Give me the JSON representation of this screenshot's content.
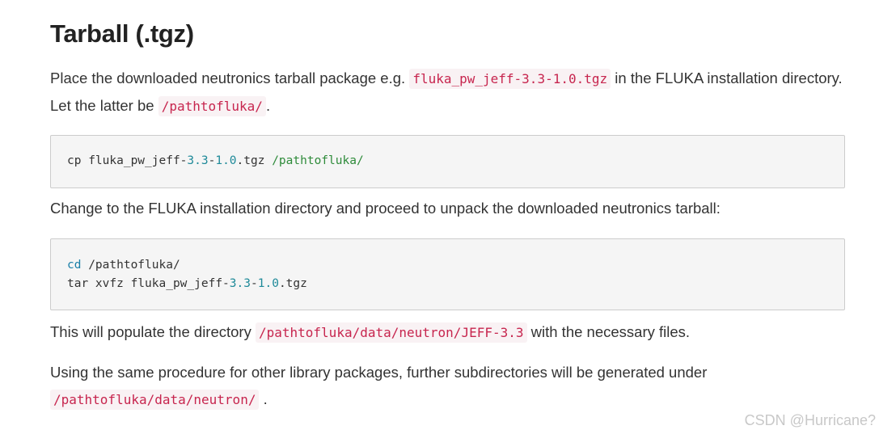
{
  "heading": "Tarball (.tgz)",
  "para1": {
    "t1": "Place the downloaded neutronics tarball package e.g. ",
    "code1": "fluka_pw_jeff-3.3-1.0.tgz",
    "t2": " in the FLUKA installation directory. Let the latter be ",
    "code2": "/pathtofluka/",
    "t3": "."
  },
  "code_block_1": {
    "line1": {
      "a": "cp fluka_pw_jeff-",
      "n1": "3.3",
      "b": "-",
      "n2": "1.0",
      "c": ".tgz ",
      "s": "/pathtofluka/"
    }
  },
  "para2": "Change to the FLUKA installation directory and proceed to unpack the downloaded neutronics tarball:",
  "code_block_2": {
    "line1": {
      "kw": "cd",
      "rest": " /pathtofluka/"
    },
    "line2": {
      "a": "tar xvfz fluka_pw_jeff-",
      "n1": "3.3",
      "b": "-",
      "n2": "1.0",
      "c": ".tgz"
    }
  },
  "para3": {
    "t1": "This will populate the directory ",
    "code": "/pathtofluka/data/neutron/JEFF-3.3",
    "t2": " with the necessary files."
  },
  "para4": {
    "t1": "Using the same procedure for other library packages, further subdirectories will be generated under ",
    "code": "/pathtofluka/data/neutron/",
    "t2": " ."
  },
  "watermark": "CSDN @Hurricane?"
}
